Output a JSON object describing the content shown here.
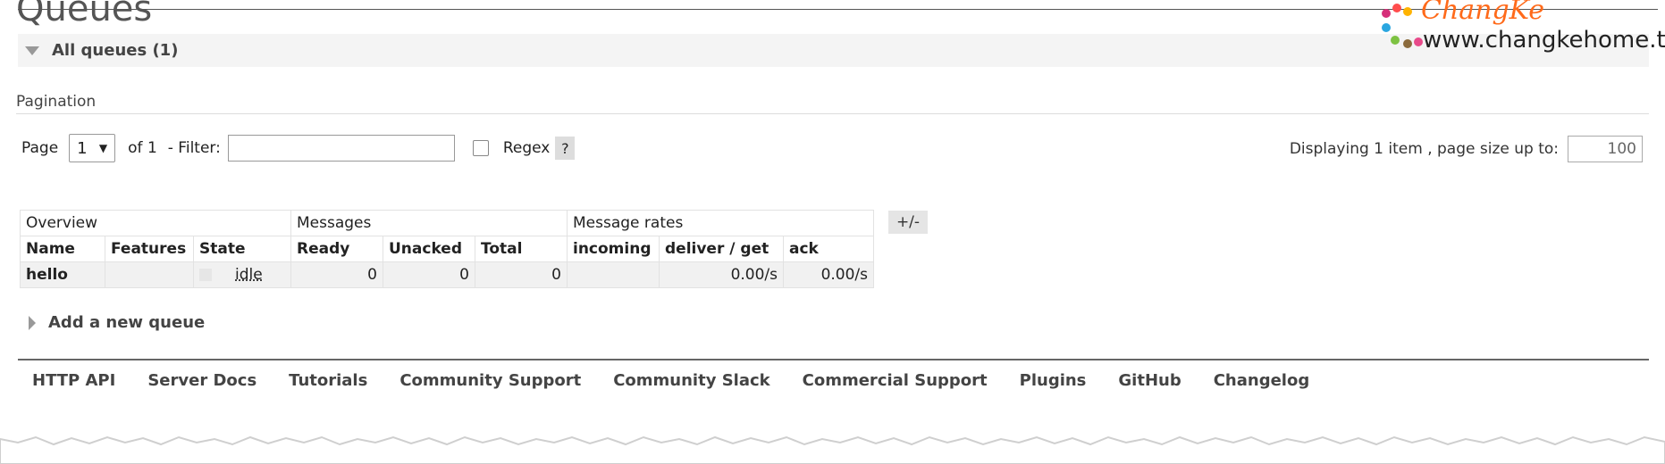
{
  "page": {
    "title": "Queues"
  },
  "section": {
    "title": "All queues (1)"
  },
  "pagination": {
    "label": "Pagination",
    "page_label": "Page",
    "page_value": "1",
    "of_text": "of 1",
    "filter_label": "- Filter:",
    "filter_value": "",
    "regex_label": "Regex",
    "help_label": "?",
    "display_text": "Displaying 1 item , page size up to:",
    "page_size": "100"
  },
  "table": {
    "groups": [
      "Overview",
      "Messages",
      "Message rates"
    ],
    "headers": [
      "Name",
      "Features",
      "State",
      "Ready",
      "Unacked",
      "Total",
      "incoming",
      "deliver / get",
      "ack"
    ],
    "rows": [
      {
        "name": "hello",
        "features": "",
        "state": "idle",
        "ready": "0",
        "unacked": "0",
        "total": "0",
        "incoming": "",
        "deliver_get": "0.00/s",
        "ack": "0.00/s"
      }
    ],
    "plusminus": "+/-"
  },
  "add_queue": {
    "label": "Add a new queue"
  },
  "footer": {
    "links": [
      "HTTP API",
      "Server Docs",
      "Tutorials",
      "Community Support",
      "Community Slack",
      "Commercial Support",
      "Plugins",
      "GitHub",
      "Changelog"
    ]
  },
  "watermark": {
    "name": "ChangKe",
    "url": "www.changkehome.top"
  },
  "icons": {
    "collapse": "triangle-down-icon",
    "expand": "triangle-right-icon",
    "select": "chevron-down-icon"
  },
  "colors": {
    "brand_orange": "#ff6a1a",
    "bar_gray": "#f4f4f4",
    "row_gray": "#f1f1f1"
  }
}
